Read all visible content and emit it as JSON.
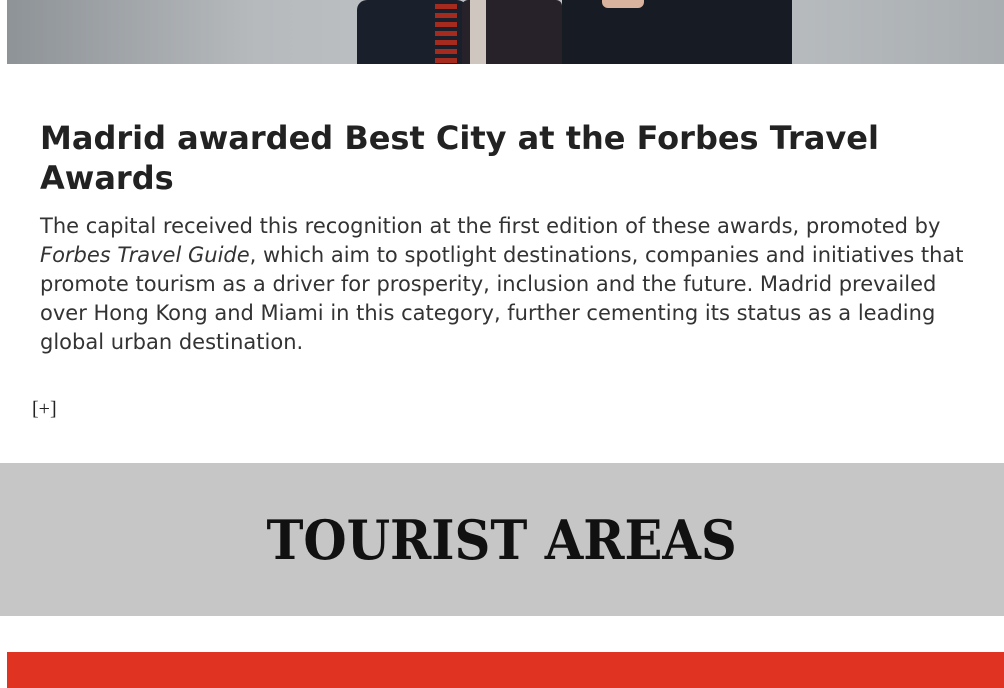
{
  "hero": {
    "image_alt": "Award ceremony photo (cropped)"
  },
  "article": {
    "title": "Madrid awarded Best City at the Forbes Travel Awards",
    "body_part1": "The capital received this recognition at the first edition of these awards, promoted by ",
    "body_italic": "Forbes Travel Guide",
    "body_part2": ", which aim to spotlight destinations, companies and initiatives that promote tourism as a driver for prosperity, inclusion and the future. Madrid prevailed over Hong Kong and Miami in this category, further cementing its status as a leading global urban destination."
  },
  "more_toggle": {
    "label": "[+]"
  },
  "section": {
    "title": "TOURIST AREAS",
    "background": "#c6c6c6"
  },
  "footer_bar": {
    "color": "#e03321"
  }
}
